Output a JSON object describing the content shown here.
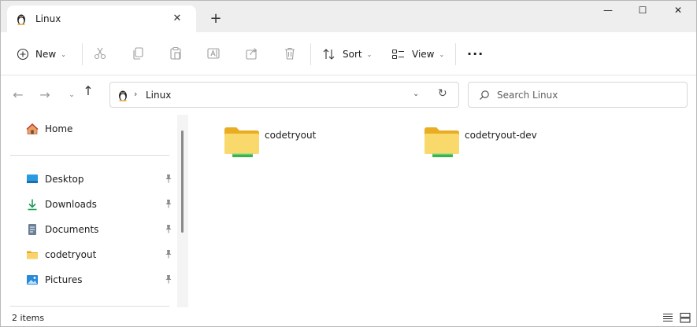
{
  "tab": {
    "title": "Linux",
    "close_glyph": "✕",
    "icon": "linux-penguin-icon"
  },
  "new_tab_glyph": "+",
  "window_controls": {
    "minimize": "—",
    "maximize": "☐",
    "close": "✕"
  },
  "commandbar": {
    "new_label": "New",
    "sort_label": "Sort",
    "view_label": "View",
    "caret_glyph": "⌄",
    "more_glyph": "···"
  },
  "nav": {
    "back": "←",
    "forward": "→",
    "recent": "⌄",
    "up": "↑"
  },
  "address": {
    "chevron": "›",
    "path": "Linux",
    "dropdown": "⌄",
    "refresh": "↻"
  },
  "search": {
    "placeholder": "Search Linux",
    "value": ""
  },
  "sidebar": {
    "home": "Home",
    "items": [
      {
        "label": "Desktop",
        "icon": "desktop-icon"
      },
      {
        "label": "Downloads",
        "icon": "download-icon"
      },
      {
        "label": "Documents",
        "icon": "document-icon"
      },
      {
        "label": "codetryout",
        "icon": "folder-icon"
      },
      {
        "label": "Pictures",
        "icon": "pictures-icon"
      }
    ]
  },
  "folders": [
    {
      "name": "codetryout"
    },
    {
      "name": "codetryout-dev"
    }
  ],
  "status": {
    "text": "2 items"
  },
  "colors": {
    "accent": "#0067c0",
    "folder_yellow": "#f5c542",
    "folder_green": "#3cb34a"
  }
}
